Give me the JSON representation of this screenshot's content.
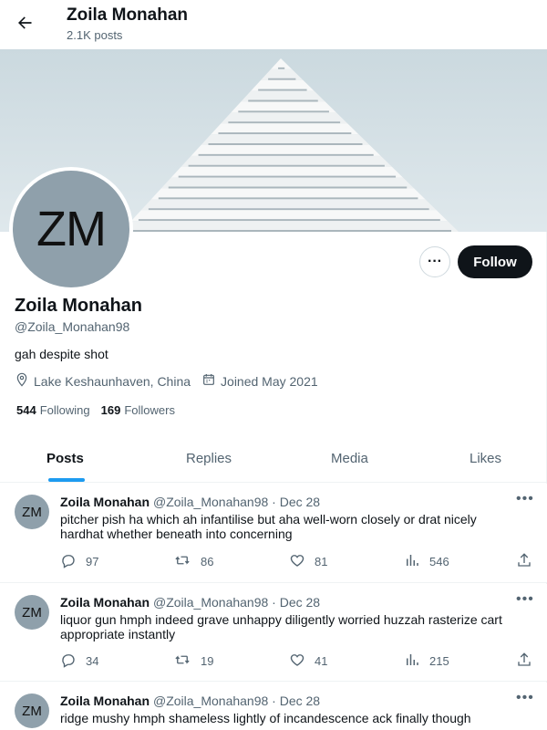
{
  "header": {
    "name": "Zoila Monahan",
    "post_count": "2.1K posts"
  },
  "profile": {
    "avatar_initials": "ZM",
    "name": "Zoila Monahan",
    "handle": "@Zoila_Monahan98",
    "bio": "gah despite shot",
    "location": "Lake Keshaunhaven, China",
    "joined": "Joined May 2021",
    "following_count": "544",
    "following_label": "Following",
    "followers_count": "169",
    "followers_label": "Followers",
    "more_label": "···",
    "follow_label": "Follow"
  },
  "tabs": [
    {
      "label": "Posts",
      "active": true
    },
    {
      "label": "Replies",
      "active": false
    },
    {
      "label": "Media",
      "active": false
    },
    {
      "label": "Likes",
      "active": false
    }
  ],
  "posts": [
    {
      "initials": "ZM",
      "name": "Zoila Monahan",
      "meta": "@Zoila_Monahan98 · Dec 28",
      "text": "pitcher pish ha which ah infantilise but aha well-worn closely or drat nicely hardhat whether beneath into concerning",
      "replies": "97",
      "reposts": "86",
      "likes": "81",
      "views": "546"
    },
    {
      "initials": "ZM",
      "name": "Zoila Monahan",
      "meta": "@Zoila_Monahan98 · Dec 28",
      "text": "liquor gun hmph indeed grave unhappy diligently worried huzzah rasterize cart appropriate instantly",
      "replies": "34",
      "reposts": "19",
      "likes": "41",
      "views": "215"
    },
    {
      "initials": "ZM",
      "name": "Zoila Monahan",
      "meta": "@Zoila_Monahan98 · Dec 28",
      "text": "ridge mushy hmph shameless lightly of incandescence ack finally though",
      "replies": "",
      "reposts": "",
      "likes": "",
      "views": ""
    }
  ],
  "colors": {
    "accent": "#1d9bf0",
    "text": "#0f1419",
    "muted": "#536471",
    "follow_bg": "#0f1419"
  },
  "icons": {
    "back": "arrow-left-icon",
    "more": "more-dots-icon",
    "location": "location-pin-icon",
    "calendar": "calendar-icon",
    "reply": "reply-icon",
    "repost": "repost-icon",
    "like": "heart-icon",
    "views": "views-icon",
    "share": "share-icon"
  }
}
